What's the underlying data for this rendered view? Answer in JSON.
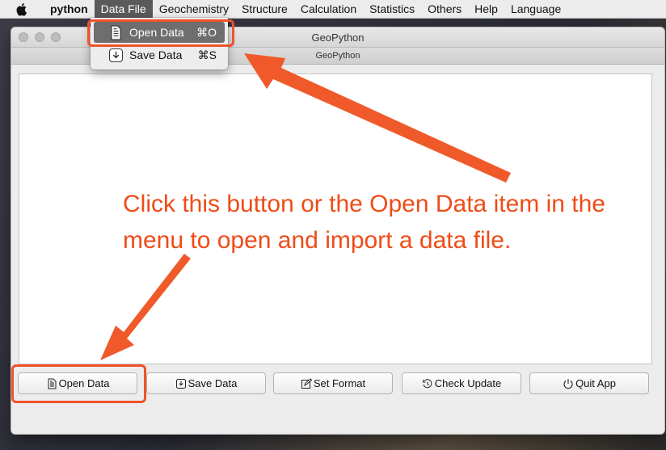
{
  "menubar": {
    "app_name": "python",
    "items": [
      {
        "label": "Data File",
        "active": true
      },
      {
        "label": "Geochemistry"
      },
      {
        "label": "Structure"
      },
      {
        "label": "Calculation"
      },
      {
        "label": "Statistics"
      },
      {
        "label": "Others"
      },
      {
        "label": "Help"
      },
      {
        "label": "Language"
      }
    ]
  },
  "window": {
    "title": "GeoPython",
    "tab_title": "GeoPython"
  },
  "dropdown": {
    "items": [
      {
        "label": "Open Data",
        "shortcut": "⌘O",
        "icon": "document-icon",
        "highlighted": true
      },
      {
        "label": "Save Data",
        "shortcut": "⌘S",
        "icon": "download-icon"
      }
    ]
  },
  "buttons": [
    {
      "label": "Open Data",
      "icon": "document-icon"
    },
    {
      "label": "Save Data",
      "icon": "save-icon"
    },
    {
      "label": "Set Format",
      "icon": "edit-icon"
    },
    {
      "label": "Check Update",
      "icon": "history-icon"
    },
    {
      "label": "Quit App",
      "icon": "power-icon"
    }
  ],
  "annotation": {
    "text": "Click this button or the Open Data item in the menu to open and import a data file.",
    "color": "#ee4c17"
  }
}
